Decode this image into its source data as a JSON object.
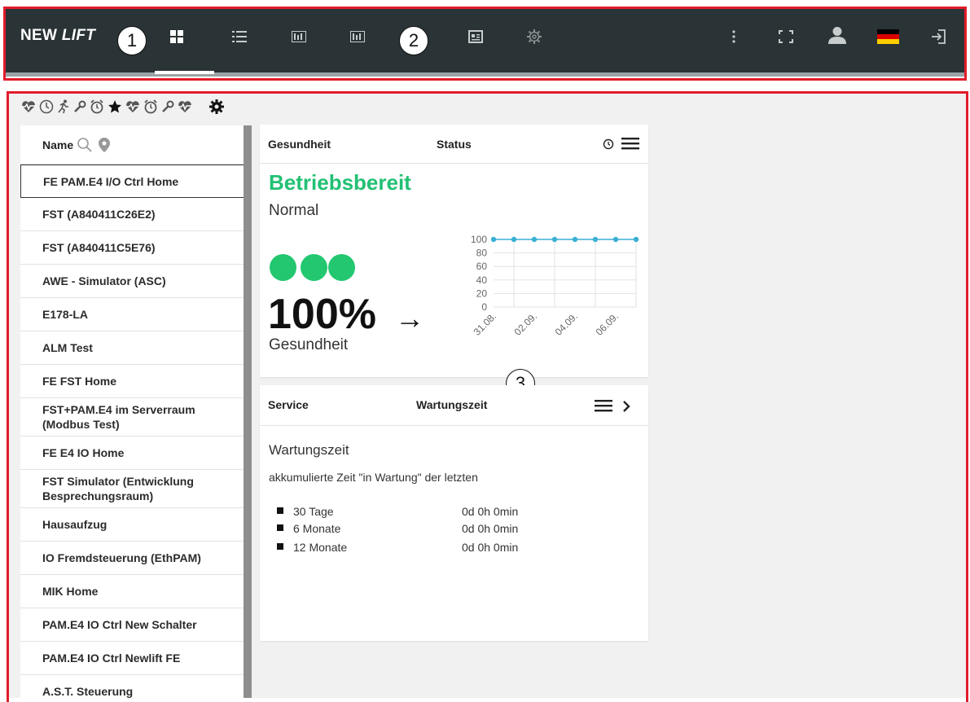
{
  "header": {
    "brand_main": "NEW",
    "brand_italic": "LIFT",
    "nav_icons": [
      "dashboard-grid-icon",
      "list-icon",
      "panel-icon",
      "panel-icon",
      "report-icon",
      "gear-icon"
    ],
    "right_icons": [
      "more-vertical-icon",
      "fullscreen-icon",
      "user-icon",
      "german-flag-icon",
      "logout-icon"
    ]
  },
  "callouts": {
    "c1": "1",
    "c2": "2",
    "c3": "3"
  },
  "filters": {
    "icons": [
      "heartbeat-icon",
      "clock-icon",
      "running-icon",
      "wrench-icon",
      "alarm-icon",
      "star-icon",
      "heartbeat-icon",
      "alarm-icon",
      "wrench-icon",
      "heartbeat-icon",
      "settings-icon"
    ]
  },
  "list": {
    "header_label": "Name",
    "items": [
      "FE PAM.E4 I/O Ctrl Home",
      "FST (A840411C26E2)",
      "FST (A840411C5E76)",
      "AWE - Simulator (ASC)",
      "E178-LA",
      "ALM Test",
      "FE FST Home",
      "FST+PAM.E4 im Serverraum (Modbus Test)",
      "FE E4 IO Home",
      "FST Simulator (Entwicklung Besprechungsraum)",
      "Hausaufzug",
      "IO Fremdsteuerung (EthPAM)",
      "MIK Home",
      "PAM.E4 IO Ctrl New Schalter",
      "PAM.E4 IO Ctrl Newlift FE",
      "A.S.T. Steuerung"
    ]
  },
  "health_card": {
    "title_left": "Gesundheit",
    "title_center": "Status",
    "status": "Betriebsbereit",
    "substatus": "Normal",
    "percent": "100%",
    "arrow": "→",
    "label": "Gesundheit",
    "color_good": "#22c074"
  },
  "service_card": {
    "title_left": "Service",
    "title_center": "Wartungszeit",
    "heading": "Wartungszeit",
    "description": "akkumulierte Zeit \"in Wartung\" der letzten",
    "rows": [
      {
        "label": "30 Tage",
        "value": "0d 0h 0min"
      },
      {
        "label": "6 Monate",
        "value": "0d 0h 0min"
      },
      {
        "label": "12 Monate",
        "value": "0d 0h 0min"
      }
    ]
  },
  "chart_data": {
    "type": "line",
    "categories": [
      "31.08.",
      "01.09.",
      "02.09.",
      "03.09.",
      "04.09.",
      "05.09.",
      "06.09.",
      "07.09."
    ],
    "tick_labels": [
      "31.08.",
      "02.09.",
      "04.09.",
      "06.09."
    ],
    "series": [
      {
        "values": [
          100,
          100,
          100,
          100,
          100,
          100,
          100,
          100
        ]
      }
    ],
    "yticks": [
      0,
      20,
      40,
      60,
      80,
      100
    ],
    "ylim": [
      0,
      100
    ],
    "grid": true,
    "line_color": "#3ab0d4"
  }
}
